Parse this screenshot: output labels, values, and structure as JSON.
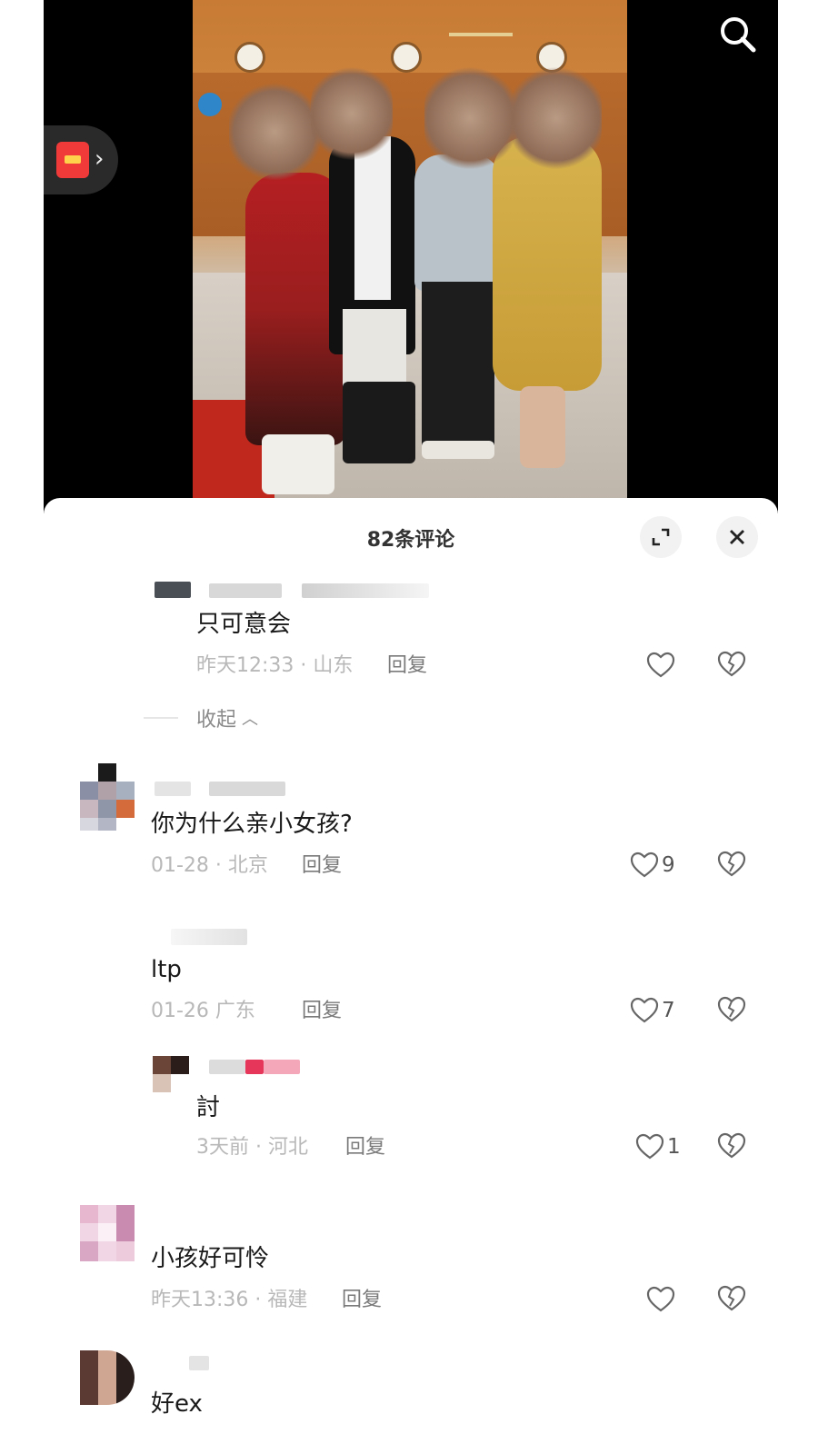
{
  "header": {
    "comment_count_title": "82条评论"
  },
  "icons": {
    "search": "search-icon",
    "red_packet": "red-packet-icon",
    "expand": "expand-icon",
    "close": "close-icon",
    "like": "heart-icon",
    "dislike": "broken-heart-icon"
  },
  "colors": {
    "accent_red": "#f03a3a"
  },
  "comments": [
    {
      "text": "只可意会",
      "meta": "昨天12:33 · 山东",
      "reply": "回复",
      "likes": ""
    },
    {
      "text": "你为什么亲小女孩?",
      "meta": "01-28 · 北京",
      "reply": "回复",
      "likes": "9"
    },
    {
      "text": "ltp",
      "meta": "01-26  广东",
      "reply": "回复",
      "likes": "7"
    },
    {
      "text": "討",
      "meta": "3天前 · 河北",
      "reply": "回复",
      "likes": "1"
    },
    {
      "text": "小孩好可怜",
      "meta": "昨天13:36 · 福建",
      "reply": "回复",
      "likes": ""
    },
    {
      "text": "好ex",
      "meta": "",
      "reply": "",
      "likes": ""
    }
  ],
  "collapse_label": "收起"
}
